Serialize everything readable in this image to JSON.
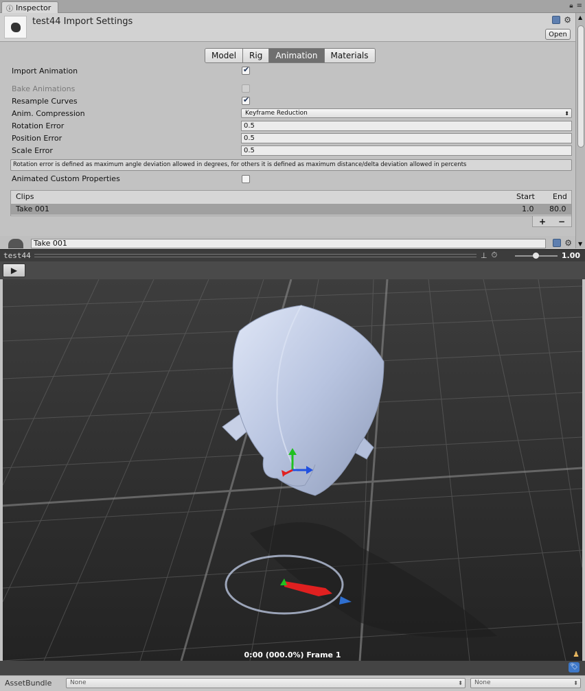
{
  "window": {
    "tab_label": "Inspector",
    "tab_icon": "info-icon"
  },
  "header": {
    "title": "test44 Import Settings",
    "open_label": "Open"
  },
  "tabs": [
    {
      "label": "Model",
      "active": false
    },
    {
      "label": "Rig",
      "active": false
    },
    {
      "label": "Animation",
      "active": true
    },
    {
      "label": "Materials",
      "active": false
    }
  ],
  "settings": {
    "import_animation": {
      "label": "Import Animation",
      "checked": true
    },
    "bake_animations": {
      "label": "Bake Animations",
      "checked": false,
      "disabled": true
    },
    "resample_curves": {
      "label": "Resample Curves",
      "checked": true
    },
    "anim_compression": {
      "label": "Anim. Compression",
      "value": "Keyframe Reduction"
    },
    "rotation_error": {
      "label": "Rotation Error",
      "value": "0.5"
    },
    "position_error": {
      "label": "Position Error",
      "value": "0.5"
    },
    "scale_error": {
      "label": "Scale Error",
      "value": "0.5"
    },
    "help_text": "Rotation error is defined as maximum angle deviation allowed in degrees, for others it is defined as maximum distance/delta deviation allowed in percents",
    "animated_custom_properties": {
      "label": "Animated Custom Properties",
      "checked": false
    }
  },
  "clips": {
    "header": {
      "name": "Clips",
      "start": "Start",
      "end": "End"
    },
    "rows": [
      {
        "name": "Take 001",
        "start": "1.0",
        "end": "80.0"
      }
    ],
    "add_label": "+",
    "remove_label": "−"
  },
  "clip_editor": {
    "name_value": "Take 001"
  },
  "preview": {
    "name": "test44",
    "speed": "1.00",
    "speed_fraction": 0.5,
    "frame_info": "0:00 (000.0%) Frame 1"
  },
  "asset_bundle": {
    "label": "AssetBundle",
    "bundle_value": "None",
    "variant_value": "None"
  },
  "colors": {
    "panel_bg": "#c2c2c2",
    "active_tab": "#6f6f6f",
    "viewport_bg": "#3b3b3b",
    "axis_x": "#e02020",
    "axis_y": "#20c020",
    "axis_z": "#2050e0"
  }
}
